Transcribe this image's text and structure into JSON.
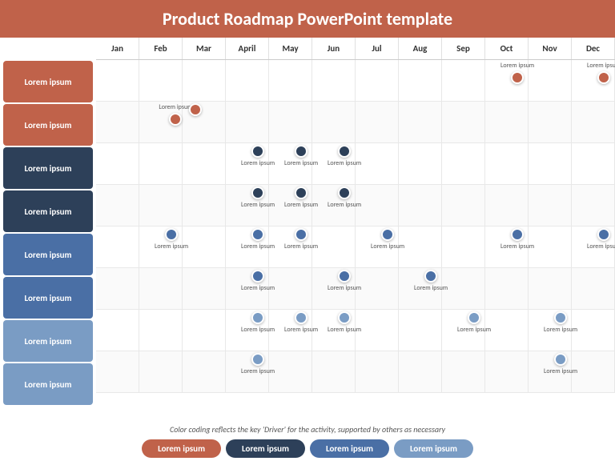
{
  "title": "Product Roadmap PowerPoint template",
  "months": [
    "Jan",
    "Feb",
    "Mar",
    "April",
    "May",
    "Jun",
    "Jul",
    "Aug",
    "Sep",
    "Oct",
    "Nov",
    "Dec"
  ],
  "rows": [
    {
      "label": "Lorem ipsum",
      "color": "#c0624a",
      "milestones": [
        {
          "month": 9,
          "offset": 0.5,
          "label": "Lorem ipsum"
        },
        {
          "month": 11,
          "offset": 0.5,
          "label": "Lorem ipsum"
        }
      ]
    },
    {
      "label": "Lorem ipsum",
      "color": "#c0624a",
      "milestones": [
        {
          "month": 1,
          "offset": 0.6,
          "label": "Lorem ipsum"
        },
        {
          "month": 2,
          "offset": 0.3,
          "label": "",
          "dot_only": true
        }
      ]
    },
    {
      "label": "Lorem ipsum",
      "color": "#2d4059",
      "milestones": [
        {
          "month": 3,
          "offset": 0.5,
          "label": "Lorem ipsum"
        },
        {
          "month": 4,
          "offset": 0.5,
          "label": "Lorem ipsum"
        },
        {
          "month": 5,
          "offset": 0.5,
          "label": "Lorem ipsum"
        }
      ]
    },
    {
      "label": "Lorem ipsum",
      "color": "#2d4059",
      "milestones": [
        {
          "month": 3,
          "offset": 0.5,
          "label": "Lorem ipsum"
        },
        {
          "month": 4,
          "offset": 0.5,
          "label": "Lorem ipsum"
        },
        {
          "month": 5,
          "offset": 0.5,
          "label": "Lorem ipsum"
        }
      ]
    },
    {
      "label": "Lorem ipsum",
      "color": "#4a6fa5",
      "milestones": [
        {
          "month": 1,
          "offset": 0.5,
          "label": "Lorem ipsum"
        },
        {
          "month": 3,
          "offset": 0.5,
          "label": "Lorem ipsum"
        },
        {
          "month": 4,
          "offset": 0.5,
          "label": "Lorem ipsum"
        },
        {
          "month": 6,
          "offset": 0.5,
          "label": "Lorem ipsum"
        },
        {
          "month": 9,
          "offset": 0.5,
          "label": "Lorem ipsum"
        },
        {
          "month": 11,
          "offset": 0.5,
          "label": "Lorem ipsum"
        }
      ]
    },
    {
      "label": "Lorem ipsum",
      "color": "#4a6fa5",
      "milestones": [
        {
          "month": 3,
          "offset": 0.5,
          "label": "Lorem ipsum"
        },
        {
          "month": 5,
          "offset": 0.5,
          "label": "Lorem ipsum"
        },
        {
          "month": 7,
          "offset": 0.5,
          "label": "Lorem ipsum"
        }
      ]
    },
    {
      "label": "Lorem ipsum",
      "color": "#7a9cc4",
      "milestones": [
        {
          "month": 3,
          "offset": 0.5,
          "label": "Lorem ipsum"
        },
        {
          "month": 4,
          "offset": 0.5,
          "label": "Lorem ipsum"
        },
        {
          "month": 5,
          "offset": 0.5,
          "label": "Lorem ipsum"
        },
        {
          "month": 8,
          "offset": 0.5,
          "label": "Lorem ipsum"
        },
        {
          "month": 10,
          "offset": 0.5,
          "label": "Lorem ipsum"
        }
      ]
    },
    {
      "label": "Lorem ipsum",
      "color": "#7a9cc4",
      "milestones": [
        {
          "month": 3,
          "offset": 0.5,
          "label": "Lorem ipsum"
        },
        {
          "month": 10,
          "offset": 0.5,
          "label": "Lorem ipsum"
        }
      ]
    }
  ],
  "footer_text": "Color coding reflects the key 'Driver' for the activity, supported by others as necessary",
  "legend": [
    {
      "label": "Lorem ipsum",
      "color": "#c0624a"
    },
    {
      "label": "Lorem ipsum",
      "color": "#2d4059"
    },
    {
      "label": "Lorem ipsum",
      "color": "#4a6fa5"
    },
    {
      "label": "Lorem ipsum",
      "color": "#7a9cc4"
    }
  ],
  "milestone_dot_colors": {
    "row0": "#c0624a",
    "row1": "#c0624a",
    "row2": "#2d4059",
    "row3": "#2d4059",
    "row4": "#4a6fa5",
    "row5": "#4a6fa5",
    "row6": "#7a9cc4",
    "row7": "#7a9cc4"
  }
}
